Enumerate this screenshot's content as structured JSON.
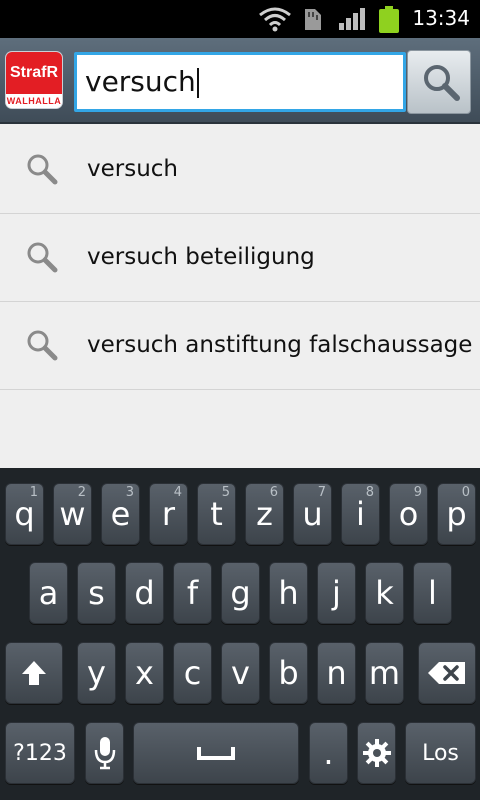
{
  "status_bar": {
    "time": "13:34",
    "icons": [
      "wifi-icon",
      "sd-card-icon",
      "signal-icon",
      "battery-icon"
    ]
  },
  "app": {
    "logo_text": "StrafR",
    "logo_subtext": "WALHALLA"
  },
  "search": {
    "value": "versuch",
    "button_icon": "search-icon"
  },
  "suggestions": [
    {
      "icon": "search-icon",
      "label": "versuch"
    },
    {
      "icon": "search-icon",
      "label": "versuch beteiligung"
    },
    {
      "icon": "search-icon",
      "label": "versuch anstiftung falschaussage"
    }
  ],
  "keyboard": {
    "row1": [
      {
        "key": "q",
        "hint": "1"
      },
      {
        "key": "w",
        "hint": "2"
      },
      {
        "key": "e",
        "hint": "3"
      },
      {
        "key": "r",
        "hint": "4"
      },
      {
        "key": "t",
        "hint": "5"
      },
      {
        "key": "z",
        "hint": "6"
      },
      {
        "key": "u",
        "hint": "7"
      },
      {
        "key": "i",
        "hint": "8"
      },
      {
        "key": "o",
        "hint": "9"
      },
      {
        "key": "p",
        "hint": "0"
      }
    ],
    "row2": [
      {
        "key": "a"
      },
      {
        "key": "s"
      },
      {
        "key": "d"
      },
      {
        "key": "f"
      },
      {
        "key": "g"
      },
      {
        "key": "h"
      },
      {
        "key": "j"
      },
      {
        "key": "k"
      },
      {
        "key": "l"
      }
    ],
    "row3": [
      {
        "key": "y"
      },
      {
        "key": "x"
      },
      {
        "key": "c"
      },
      {
        "key": "v"
      },
      {
        "key": "b"
      },
      {
        "key": "n"
      },
      {
        "key": "m"
      }
    ],
    "shift_icon": "shift-arrow-icon",
    "delete_icon": "backspace-icon",
    "symbols_label": "?123",
    "mic_icon": "microphone-icon",
    "space_icon": "space-icon",
    "period_label": ".",
    "settings_icon": "gear-icon",
    "go_label": "Los"
  }
}
